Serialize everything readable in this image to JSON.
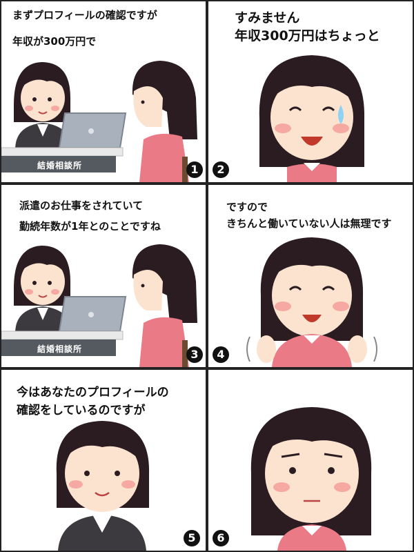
{
  "panels": [
    {
      "number": "1",
      "lines": [
        "まずプロフィールの確認ですが",
        "年収が300万円で"
      ],
      "desk_sign": "結婚相談所"
    },
    {
      "number": "2",
      "lines": [
        "すみません",
        "年収300万円はちょっと"
      ]
    },
    {
      "number": "3",
      "lines": [
        "派遣のお仕事をされていて",
        "勤続年数が1年とのことですね"
      ],
      "desk_sign": "結婚相談所"
    },
    {
      "number": "4",
      "lines": [
        "ですので",
        "きちんと働いていない人は無理です"
      ]
    },
    {
      "number": "5",
      "lines": [
        "今はあなたのプロフィールの",
        "確認をしているのですが"
      ]
    },
    {
      "number": "6",
      "lines": []
    }
  ],
  "colors": {
    "hair": "#2b1c22",
    "skin": "#fbe3cf",
    "cheek": "#f6a9a2",
    "pink_top": "#e97a86",
    "suit": "#3c3a3e",
    "laptop": "#a9b1bd",
    "desk_sign": "#555a61"
  }
}
